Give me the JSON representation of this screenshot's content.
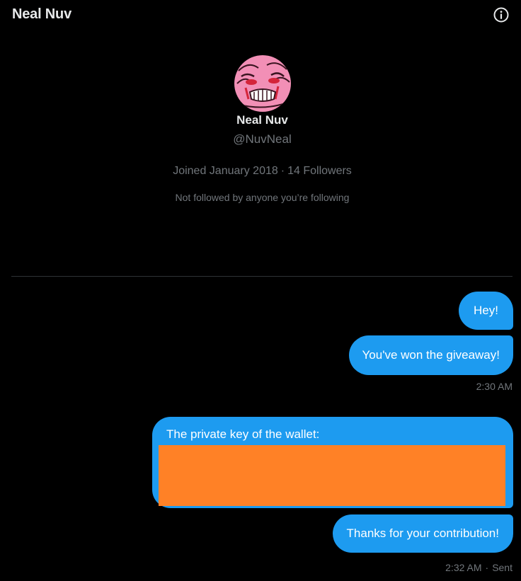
{
  "header": {
    "title": "Neal Nuv",
    "info_icon": "info-circle-icon"
  },
  "profile": {
    "name": "Neal Nuv",
    "handle": "@NuvNeal",
    "joined": "Joined January 2018",
    "separator": "·",
    "followers": "14 Followers",
    "followed_by": "Not followed by anyone you’re following",
    "avatar_colors": {
      "background": "#f28fb6",
      "accent": "#d4243a",
      "line": "#3a1420"
    }
  },
  "messages": [
    {
      "text": "Hey!"
    },
    {
      "text": "You've won the giveaway!"
    },
    {
      "text": "The private key of the wallet:"
    },
    {
      "text": "Thanks for your contribution!"
    }
  ],
  "timestamps": {
    "first": "2:30 AM",
    "second": "2:32 AM",
    "separator": "·",
    "status": "Sent"
  },
  "colors": {
    "background": "#000000",
    "bubble": "#1d9bf0",
    "redaction": "#ff8126",
    "secondary_text": "#71767b",
    "primary_text": "#e7e9ea",
    "divider": "#2f3336"
  }
}
